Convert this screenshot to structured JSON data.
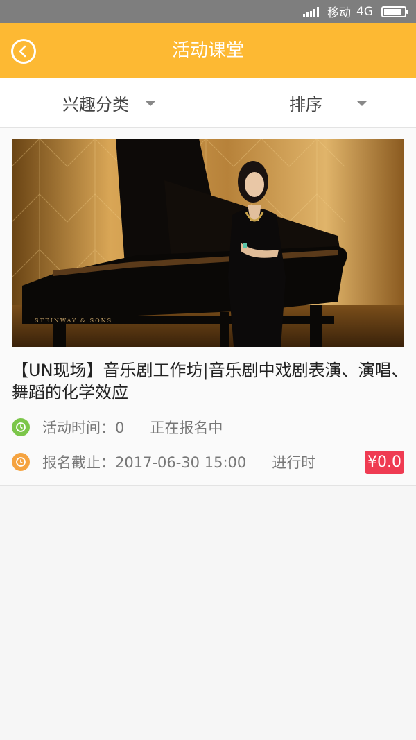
{
  "status_bar": {
    "carrier": "移动",
    "network": "4G",
    "battery_level": 0.85
  },
  "header": {
    "title": "活动课堂",
    "back_icon": "chevron-left-icon"
  },
  "filters": {
    "interest_label": "兴趣分类",
    "sort_label": "排序"
  },
  "activity": {
    "title": "【UN现场】音乐剧工作坊|音乐剧中戏剧表演、演唱、舞蹈的化学效应",
    "time_label": "活动时间：0",
    "signup_status": "正在报名中",
    "deadline_label": "报名截止：2017-06-30 15:00",
    "progress_status": "进行时",
    "price": "¥0.0",
    "piano_brand": "STEINWAY & SONS"
  },
  "colors": {
    "header_bg": "#fdb933",
    "status_bar_bg": "#7e7e7e",
    "price_bg": "#ef3b52",
    "clock_green": "#7cc64a",
    "clock_orange": "#f5a340"
  }
}
